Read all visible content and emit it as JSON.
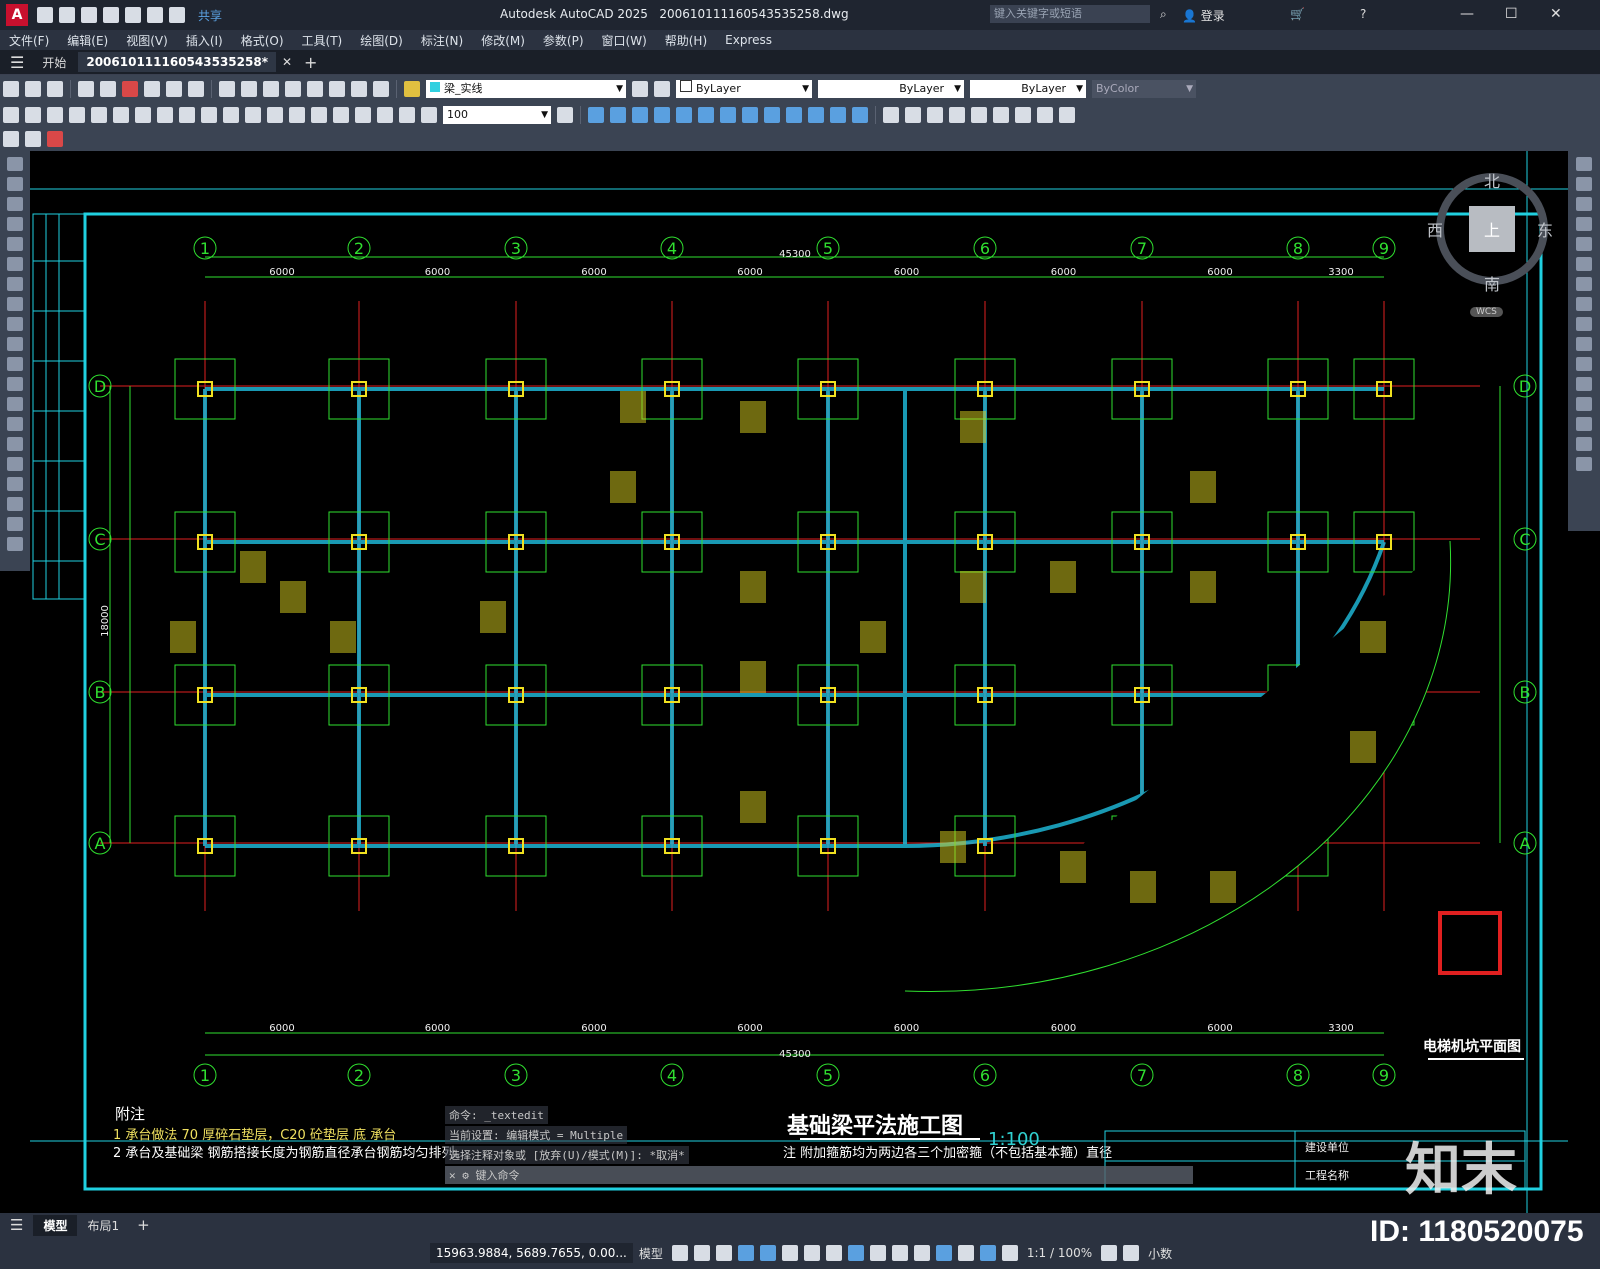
{
  "app": {
    "logo": "A",
    "title": "Autodesk AutoCAD 2025",
    "filename": "20061011116​0543535258.dwg",
    "share": "共享",
    "search_placeholder": "键入关键字或短语",
    "login": "登录"
  },
  "menu": [
    "文件(F)",
    "编辑(E)",
    "视图(V)",
    "插入(I)",
    "格式(O)",
    "工具(T)",
    "绘图(D)",
    "标注(N)",
    "修改(M)",
    "参数(P)",
    "窗口(W)",
    "帮助(H)",
    "Express"
  ],
  "tabs": {
    "start": "开始",
    "doc": "20061011116​0543535258*"
  },
  "toolbar": {
    "layer": "梁_实线",
    "color": "ByLayer",
    "linetype": "ByLayer",
    "lineweight": "ByLayer",
    "plotstyle": "ByColor",
    "scale": "100"
  },
  "viewcube": {
    "north": "北",
    "south": "南",
    "east": "东",
    "west": "西",
    "face": "上",
    "wcs": "WCS"
  },
  "drawing": {
    "axes_top": [
      "1",
      "2",
      "3",
      "4",
      "5",
      "6",
      "7",
      "8",
      "9"
    ],
    "axes_side": [
      "D",
      "C",
      "B",
      "A"
    ],
    "spans": [
      "6000",
      "6000",
      "6000",
      "6000",
      "6000",
      "6000",
      "6000",
      "3300"
    ],
    "total": "45300",
    "height_total": "18000",
    "title": "基础梁平法施工图",
    "scale": "1:100",
    "pit_title": "电梯机坑平面图",
    "notes_head": "附注",
    "note1": "1 承台做法 70  厚碎石垫层，C20   砼垫层   底   承台",
    "note2": "2 承台及基础梁 钢筋搭接长度为钢筋直径承台钢筋均匀排列。",
    "note_right": "注 附加箍筋均为两边各三个加密箍（不包括基本箍）直径",
    "table_build": "建设单位",
    "table_project": "工程名称"
  },
  "cmd": {
    "line1": "命令: _textedit",
    "line2": "当前设置: 编辑模式 = Multiple",
    "line3": "选择注释对象或 [放弃(U)/模式(M)]: *取消*",
    "line4": "键入命令"
  },
  "layouts": [
    "模型",
    "布局1"
  ],
  "status": {
    "coords": "15963.9884, 5689.7655, 0.00...",
    "model": "模型",
    "scale": "1:1 / 100%",
    "units": "小数"
  },
  "watermark": {
    "id": "ID: 1180520075",
    "brand": "知末"
  }
}
